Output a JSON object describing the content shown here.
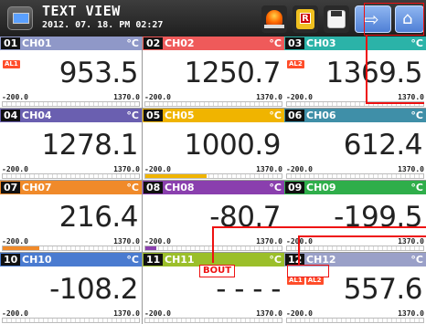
{
  "header": {
    "title": "TEXT VIEW",
    "datetime": "2012. 07. 18. PM 02:27",
    "icons": [
      "view-icon",
      "alarm-lamp-icon",
      "record-icon",
      "save-disk-icon",
      "next-arrow-icon",
      "home-icon"
    ]
  },
  "channels": [
    {
      "num": "01",
      "name": "CH01",
      "unit": "°C",
      "value": "953.5",
      "min": "-200.0",
      "max": "1370.0",
      "alarms": [
        "AL1"
      ],
      "level": 0,
      "color": "#8f98c8"
    },
    {
      "num": "02",
      "name": "CH02",
      "unit": "°C",
      "value": "1250.7",
      "min": "-200.0",
      "max": "1370.0",
      "alarms": [],
      "level": 0,
      "color": "#ef5a5a"
    },
    {
      "num": "03",
      "name": "CH03",
      "unit": "°C",
      "value": "1369.5",
      "min": "-200.0",
      "max": "1370.0",
      "alarms": [
        "AL2"
      ],
      "level": 0,
      "color": "#2bb3a8"
    },
    {
      "num": "04",
      "name": "CH04",
      "unit": "°C",
      "value": "1278.1",
      "min": "-200.0",
      "max": "1370.0",
      "alarms": [],
      "level": 0,
      "color": "#6a5fb0"
    },
    {
      "num": "05",
      "name": "CH05",
      "unit": "°C",
      "value": "1000.9",
      "min": "-200.0",
      "max": "1370.0",
      "alarms": [],
      "level": 0.45,
      "color": "#f0b400"
    },
    {
      "num": "06",
      "name": "CH06",
      "unit": "°C",
      "value": "612.4",
      "min": "-200.0",
      "max": "1370.0",
      "alarms": [],
      "level": 0,
      "color": "#3f8fa8"
    },
    {
      "num": "07",
      "name": "CH07",
      "unit": "°C",
      "value": "216.4",
      "min": "-200.0",
      "max": "1370.0",
      "alarms": [],
      "level": 0.27,
      "color": "#f08a2a"
    },
    {
      "num": "08",
      "name": "CH08",
      "unit": "°C",
      "value": "-80.7",
      "min": "-200.0",
      "max": "1370.0",
      "alarms": [],
      "level": 0.08,
      "color": "#8a3fae"
    },
    {
      "num": "09",
      "name": "CH09",
      "unit": "°C",
      "value": "-199.5",
      "min": "-200.0",
      "max": "1370.0",
      "alarms": [],
      "level": 0,
      "color": "#2fae4a"
    },
    {
      "num": "10",
      "name": "CH10",
      "unit": "°C",
      "value": "-108.2",
      "min": "-200.0",
      "max": "1370.0",
      "alarms": [],
      "level": 0,
      "color": "#4a7bd0"
    },
    {
      "num": "11",
      "name": "CH11",
      "unit": "°C",
      "value": "- - - -",
      "min": "-200.0",
      "max": "1370.0",
      "alarms": [],
      "level": 0,
      "color": "#9bbf2a"
    },
    {
      "num": "12",
      "name": "CH12",
      "unit": "°C",
      "value": "557.6",
      "min": "-200.0",
      "max": "1370.0",
      "alarms": [
        "AL1",
        "AL2"
      ],
      "level": 0,
      "color": "#9aa0c8"
    }
  ],
  "annotations": {
    "bout": "BOUT"
  }
}
